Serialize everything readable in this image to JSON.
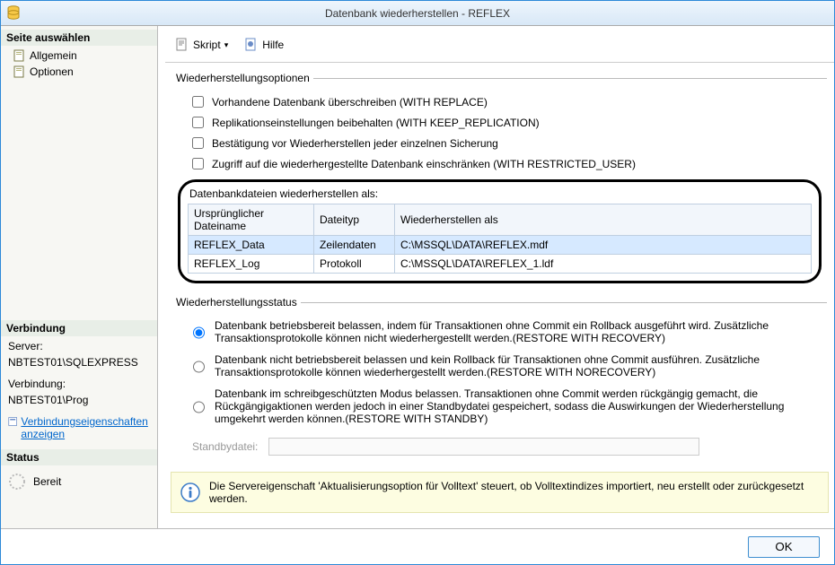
{
  "window": {
    "title": "Datenbank wiederherstellen - REFLEX"
  },
  "sidebar": {
    "select_page": "Seite auswählen",
    "items": [
      {
        "label": "Allgemein"
      },
      {
        "label": "Optionen"
      }
    ],
    "connection_hdr": "Verbindung",
    "server_lbl": "Server:",
    "server_val": "NBTEST01\\SQLEXPRESS",
    "conn_lbl": "Verbindung:",
    "conn_val": "NBTEST01\\Prog",
    "props_link": "Verbindungseigenschaften anzeigen",
    "status_hdr": "Status",
    "status_val": "Bereit"
  },
  "toolbar": {
    "script": "Skript",
    "help": "Hilfe"
  },
  "restore_opts": {
    "legend": "Wiederherstellungsoptionen",
    "c1": "Vorhandene Datenbank überschreiben (WITH REPLACE)",
    "c2": "Replikationseinstellungen beibehalten (WITH KEEP_REPLICATION)",
    "c3": "Bestätigung vor Wiederherstellen jeder einzelnen Sicherung",
    "c4": "Zugriff auf die wiederhergestellte Datenbank einschränken (WITH RESTRICTED_USER)"
  },
  "files": {
    "label": "Datenbankdateien wiederherstellen als:",
    "h1": "Ursprünglicher Dateiname",
    "h2": "Dateityp",
    "h3": "Wiederherstellen als",
    "rows": [
      {
        "orig": "REFLEX_Data",
        "type": "Zeilendaten",
        "dest": "C:\\MSSQL\\DATA\\REFLEX.mdf"
      },
      {
        "orig": "REFLEX_Log",
        "type": "Protokoll",
        "dest": "C:\\MSSQL\\DATA\\REFLEX_1.ldf"
      }
    ]
  },
  "state": {
    "legend": "Wiederherstellungsstatus",
    "r1": "Datenbank betriebsbereit belassen, indem für Transaktionen ohne Commit ein Rollback ausgeführt wird. Zusätzliche Transaktionsprotokolle können nicht wiederhergestellt werden.(RESTORE WITH RECOVERY)",
    "r2": "Datenbank nicht betriebsbereit belassen und kein Rollback für Transaktionen ohne Commit ausführen. Zusätzliche Transaktionsprotokolle können wiederhergestellt werden.(RESTORE WITH NORECOVERY)",
    "r3": "Datenbank im schreibgeschützten Modus belassen. Transaktionen ohne Commit werden rückgängig gemacht, die Rückgängigaktionen werden jedoch in einer Standbydatei gespeichert, sodass die Auswirkungen der Wiederherstellung umgekehrt werden können.(RESTORE WITH STANDBY)",
    "standby_lbl": "Standbydatei:"
  },
  "info": "Die Servereigenschaft 'Aktualisierungsoption für Volltext' steuert, ob Volltextindizes importiert, neu erstellt oder zurückgesetzt werden.",
  "buttons": {
    "ok": "OK"
  }
}
